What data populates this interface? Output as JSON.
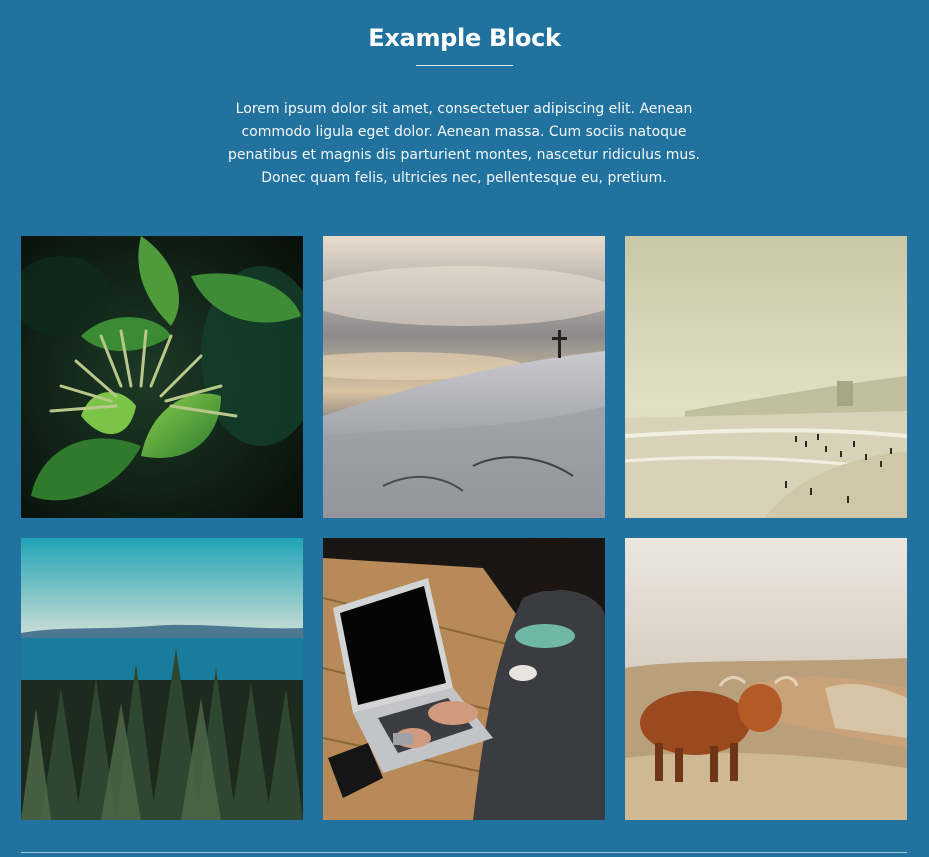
{
  "block": {
    "title": "Example Block",
    "description": "Lorem ipsum dolor sit amet, consectetuer adipiscing elit. Aenean commodo ligula eget dolor. Aenean massa. Cum sociis natoque penatibus et magnis dis parturient montes, nascetur ridiculus mus. Donec quam felis, ultricies nec, pellentesque eu, pretium."
  },
  "gallery": {
    "images": [
      {
        "name": "plant-leaves-photo"
      },
      {
        "name": "snowy-mountain-cross-photo"
      },
      {
        "name": "beach-crowd-photo"
      },
      {
        "name": "forest-lake-photo"
      },
      {
        "name": "laptop-typing-photo"
      },
      {
        "name": "highland-cow-photo"
      }
    ]
  },
  "colors": {
    "background": "#21729f",
    "text": "#ffffff"
  }
}
